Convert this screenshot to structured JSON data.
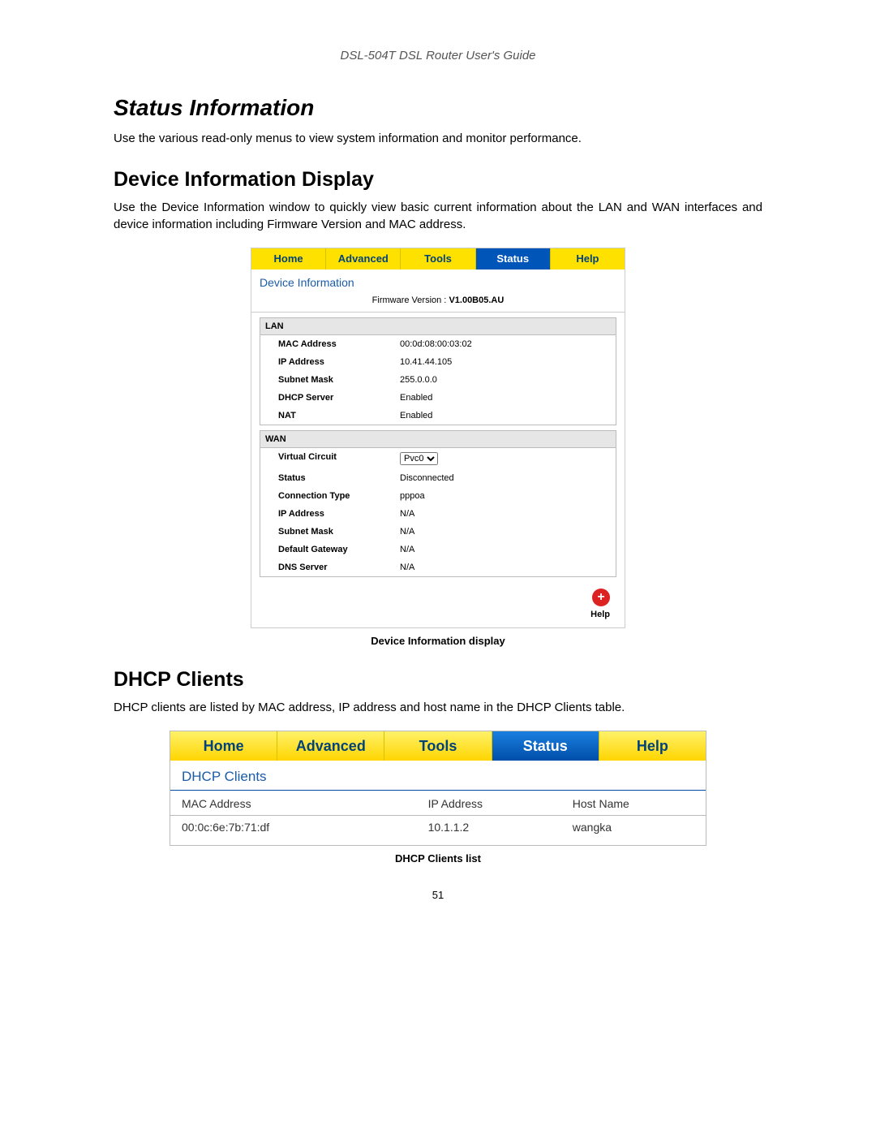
{
  "doc": {
    "header": "DSL-504T DSL Router User's Guide",
    "page_number": "51",
    "section_title": "Status Information",
    "intro": "Use the various read-only menus to view system information and monitor performance.",
    "sub1_title": "Device Information Display",
    "sub1_body": "Use the Device Information window to quickly view basic current information about the LAN and WAN interfaces and device information including Firmware Version and MAC address.",
    "caption1": "Device Information display",
    "sub2_title": "DHCP Clients",
    "sub2_body": "DHCP clients are listed by MAC address, IP address and host name in the DHCP Clients table.",
    "caption2": "DHCP Clients list"
  },
  "tabs": {
    "home": "Home",
    "advanced": "Advanced",
    "tools": "Tools",
    "status": "Status",
    "help": "Help"
  },
  "device_info": {
    "title": "Device Information",
    "firmware_label": "Firmware Version :",
    "firmware_value": "V1.00B05.AU",
    "lan": {
      "header": "LAN",
      "rows": {
        "mac_label": "MAC Address",
        "mac_value": "00:0d:08:00:03:02",
        "ip_label": "IP Address",
        "ip_value": "10.41.44.105",
        "mask_label": "Subnet Mask",
        "mask_value": "255.0.0.0",
        "dhcp_label": "DHCP Server",
        "dhcp_value": "Enabled",
        "nat_label": "NAT",
        "nat_value": "Enabled"
      }
    },
    "wan": {
      "header": "WAN",
      "rows": {
        "vc_label": "Virtual Circuit",
        "vc_value": "Pvc0",
        "status_label": "Status",
        "status_value": "Disconnected",
        "ct_label": "Connection Type",
        "ct_value": "pppoa",
        "ip_label": "IP Address",
        "ip_value": "N/A",
        "mask_label": "Subnet Mask",
        "mask_value": "N/A",
        "gw_label": "Default Gateway",
        "gw_value": "N/A",
        "dns_label": "DNS Server",
        "dns_value": "N/A"
      }
    },
    "help_label": "Help"
  },
  "dhcp_clients": {
    "title": "DHCP Clients",
    "columns": {
      "mac": "MAC Address",
      "ip": "IP Address",
      "host": "Host Name"
    },
    "rows": [
      {
        "mac": "00:0c:6e:7b:71:df",
        "ip": "10.1.1.2",
        "host": "wangka"
      }
    ]
  }
}
